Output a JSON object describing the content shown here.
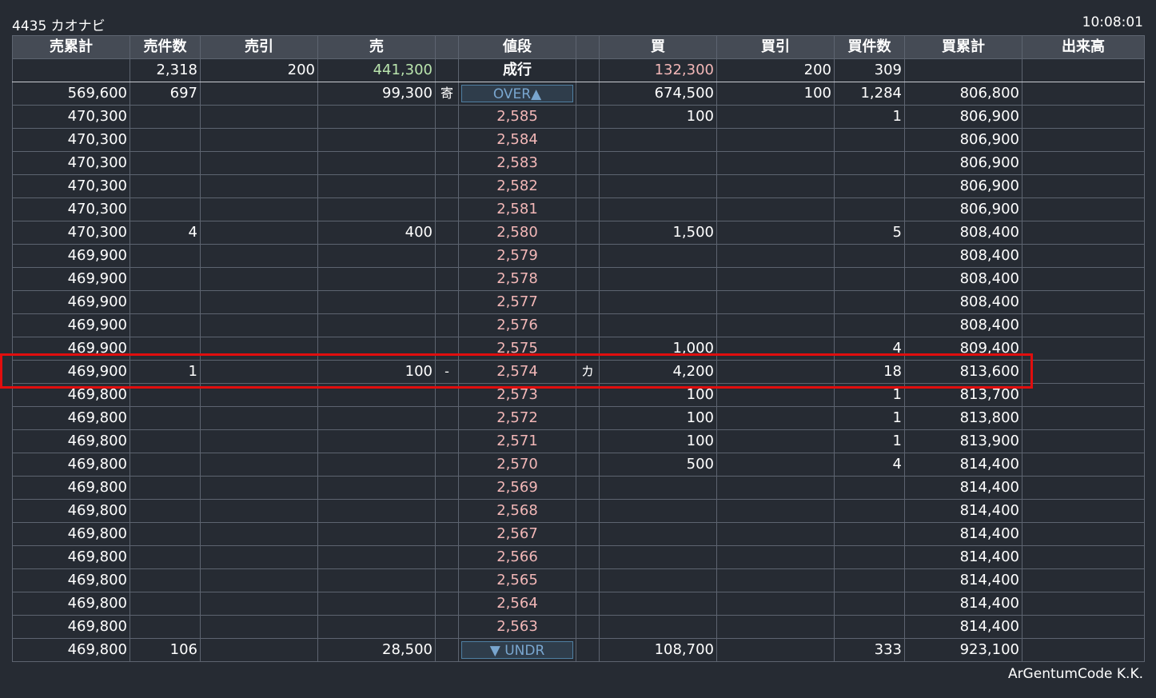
{
  "header": {
    "title": "4435 カオナビ",
    "time": "10:08:01"
  },
  "footer": {
    "credit": "ArGentumCode K.K."
  },
  "columns": [
    "売累計",
    "売件数",
    "売引",
    "売",
    "",
    "値段",
    "",
    "買",
    "買引",
    "買件数",
    "買累計",
    "出来高"
  ],
  "market_row": {
    "sell_count": "2,318",
    "sell_draw": "200",
    "sell": "441,300",
    "price": "成行",
    "buy": "132,300",
    "buy_draw": "200",
    "buy_count": "309"
  },
  "over_row": {
    "sell_cum": "569,600",
    "sell_count": "697",
    "sell": "99,300",
    "sell_flag": "寄",
    "label": "OVER▲",
    "buy": "674,500",
    "buy_draw": "100",
    "buy_count": "1,284",
    "buy_cum": "806,800"
  },
  "price_rows": [
    {
      "sell_cum": "470,300",
      "sell_count": "",
      "sell": "",
      "sell_flag": "",
      "price": "2,585",
      "buy_flag": "",
      "buy": "100",
      "buy_count": "1",
      "buy_cum": "806,900"
    },
    {
      "sell_cum": "470,300",
      "sell_count": "",
      "sell": "",
      "sell_flag": "",
      "price": "2,584",
      "buy_flag": "",
      "buy": "",
      "buy_count": "",
      "buy_cum": "806,900"
    },
    {
      "sell_cum": "470,300",
      "sell_count": "",
      "sell": "",
      "sell_flag": "",
      "price": "2,583",
      "buy_flag": "",
      "buy": "",
      "buy_count": "",
      "buy_cum": "806,900"
    },
    {
      "sell_cum": "470,300",
      "sell_count": "",
      "sell": "",
      "sell_flag": "",
      "price": "2,582",
      "buy_flag": "",
      "buy": "",
      "buy_count": "",
      "buy_cum": "806,900"
    },
    {
      "sell_cum": "470,300",
      "sell_count": "",
      "sell": "",
      "sell_flag": "",
      "price": "2,581",
      "buy_flag": "",
      "buy": "",
      "buy_count": "",
      "buy_cum": "806,900"
    },
    {
      "sell_cum": "470,300",
      "sell_count": "4",
      "sell": "400",
      "sell_flag": "",
      "price": "2,580",
      "buy_flag": "",
      "buy": "1,500",
      "buy_count": "5",
      "buy_cum": "808,400"
    },
    {
      "sell_cum": "469,900",
      "sell_count": "",
      "sell": "",
      "sell_flag": "",
      "price": "2,579",
      "buy_flag": "",
      "buy": "",
      "buy_count": "",
      "buy_cum": "808,400"
    },
    {
      "sell_cum": "469,900",
      "sell_count": "",
      "sell": "",
      "sell_flag": "",
      "price": "2,578",
      "buy_flag": "",
      "buy": "",
      "buy_count": "",
      "buy_cum": "808,400"
    },
    {
      "sell_cum": "469,900",
      "sell_count": "",
      "sell": "",
      "sell_flag": "",
      "price": "2,577",
      "buy_flag": "",
      "buy": "",
      "buy_count": "",
      "buy_cum": "808,400"
    },
    {
      "sell_cum": "469,900",
      "sell_count": "",
      "sell": "",
      "sell_flag": "",
      "price": "2,576",
      "buy_flag": "",
      "buy": "",
      "buy_count": "",
      "buy_cum": "808,400"
    },
    {
      "sell_cum": "469,900",
      "sell_count": "",
      "sell": "",
      "sell_flag": "",
      "price": "2,575",
      "buy_flag": "",
      "buy": "1,000",
      "buy_count": "4",
      "buy_cum": "809,400"
    },
    {
      "sell_cum": "469,900",
      "sell_count": "1",
      "sell": "100",
      "sell_flag": "-",
      "price": "2,574",
      "buy_flag": "カ",
      "buy": "4,200",
      "buy_count": "18",
      "buy_cum": "813,600"
    },
    {
      "sell_cum": "469,800",
      "sell_count": "",
      "sell": "",
      "sell_flag": "",
      "price": "2,573",
      "buy_flag": "",
      "buy": "100",
      "buy_count": "1",
      "buy_cum": "813,700"
    },
    {
      "sell_cum": "469,800",
      "sell_count": "",
      "sell": "",
      "sell_flag": "",
      "price": "2,572",
      "buy_flag": "",
      "buy": "100",
      "buy_count": "1",
      "buy_cum": "813,800"
    },
    {
      "sell_cum": "469,800",
      "sell_count": "",
      "sell": "",
      "sell_flag": "",
      "price": "2,571",
      "buy_flag": "",
      "buy": "100",
      "buy_count": "1",
      "buy_cum": "813,900"
    },
    {
      "sell_cum": "469,800",
      "sell_count": "",
      "sell": "",
      "sell_flag": "",
      "price": "2,570",
      "buy_flag": "",
      "buy": "500",
      "buy_count": "4",
      "buy_cum": "814,400"
    },
    {
      "sell_cum": "469,800",
      "sell_count": "",
      "sell": "",
      "sell_flag": "",
      "price": "2,569",
      "buy_flag": "",
      "buy": "",
      "buy_count": "",
      "buy_cum": "814,400"
    },
    {
      "sell_cum": "469,800",
      "sell_count": "",
      "sell": "",
      "sell_flag": "",
      "price": "2,568",
      "buy_flag": "",
      "buy": "",
      "buy_count": "",
      "buy_cum": "814,400"
    },
    {
      "sell_cum": "469,800",
      "sell_count": "",
      "sell": "",
      "sell_flag": "",
      "price": "2,567",
      "buy_flag": "",
      "buy": "",
      "buy_count": "",
      "buy_cum": "814,400"
    },
    {
      "sell_cum": "469,800",
      "sell_count": "",
      "sell": "",
      "sell_flag": "",
      "price": "2,566",
      "buy_flag": "",
      "buy": "",
      "buy_count": "",
      "buy_cum": "814,400"
    },
    {
      "sell_cum": "469,800",
      "sell_count": "",
      "sell": "",
      "sell_flag": "",
      "price": "2,565",
      "buy_flag": "",
      "buy": "",
      "buy_count": "",
      "buy_cum": "814,400"
    },
    {
      "sell_cum": "469,800",
      "sell_count": "",
      "sell": "",
      "sell_flag": "",
      "price": "2,564",
      "buy_flag": "",
      "buy": "",
      "buy_count": "",
      "buy_cum": "814,400"
    },
    {
      "sell_cum": "469,800",
      "sell_count": "",
      "sell": "",
      "sell_flag": "",
      "price": "2,563",
      "buy_flag": "",
      "buy": "",
      "buy_count": "",
      "buy_cum": "814,400"
    }
  ],
  "under_row": {
    "sell_cum": "469,800",
    "sell_count": "106",
    "sell": "28,500",
    "label": "▼ UNDR",
    "buy": "108,700",
    "buy_count": "333",
    "buy_cum": "923,100"
  },
  "highlighted_price": "2,574",
  "colors": {
    "background": "#262b33",
    "header_bg": "#454b55",
    "price_text": "#f2b7b7",
    "market_sell": "#b9e4ad",
    "market_buy": "#f2b7b7",
    "over_under": "#79a6cf",
    "highlight_border": "#e10e0e"
  }
}
